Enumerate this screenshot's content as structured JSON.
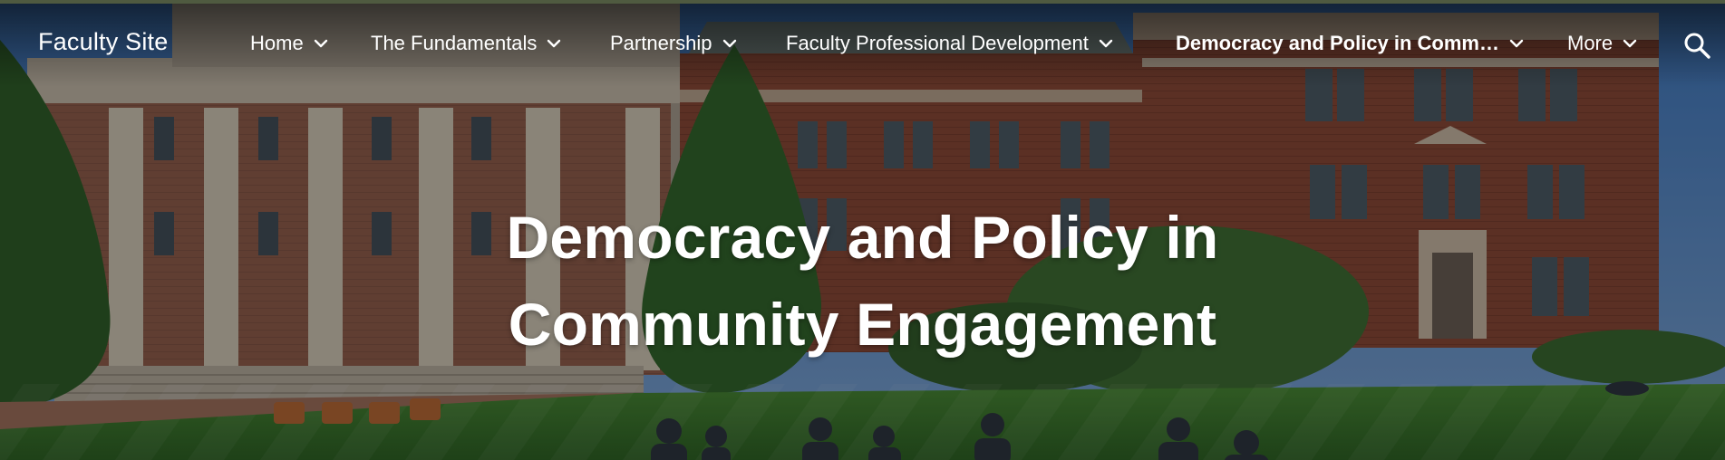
{
  "site": {
    "title": "Faculty Site"
  },
  "nav": {
    "items": [
      {
        "label": "Home"
      },
      {
        "label": "The Fundamentals"
      },
      {
        "label": "Partnership"
      },
      {
        "label": "Faculty Professional Development"
      },
      {
        "label": "Democracy and Policy in Comm…"
      },
      {
        "label": "More"
      }
    ],
    "active_index": 4
  },
  "icons": {
    "search": "search-icon",
    "dropdown": "chevron-down-icon"
  },
  "hero": {
    "title_line1": "Democracy and Policy in",
    "title_line2": "Community Engagement"
  },
  "colors": {
    "text": "#ffffff",
    "top_border": "#4f5a40",
    "lawn": "#4f8a3a",
    "brick": "#8a4b3a",
    "sky": "#4c86c6"
  }
}
